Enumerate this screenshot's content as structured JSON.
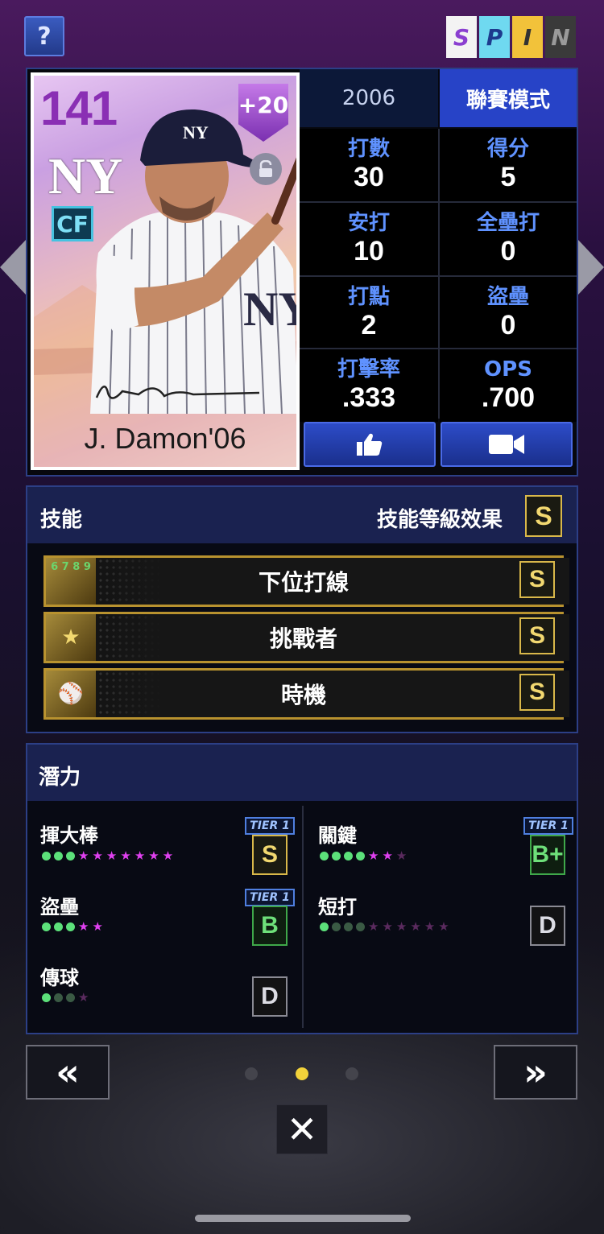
{
  "topbar": {
    "help_label": "?",
    "spin_letters": [
      {
        "letter": "S",
        "bg": "#f3f3f3",
        "color": "#8a3fd0"
      },
      {
        "letter": "P",
        "bg": "#6fd9f0",
        "color": "#1d3b8e"
      },
      {
        "letter": "I",
        "bg": "#f2c23a",
        "color": "#333333"
      },
      {
        "letter": "N",
        "bg": "#3a3a3a",
        "color": "#9a9a9a"
      }
    ]
  },
  "card": {
    "rating": "141",
    "position": "CF",
    "boost": "+20",
    "team_logo": "NY",
    "name": "J. Damon'06"
  },
  "stats": {
    "year_tab": "2006",
    "mode_tab": "聯賽模式",
    "items": [
      {
        "label": "打數",
        "value": "30"
      },
      {
        "label": "得分",
        "value": "5"
      },
      {
        "label": "安打",
        "value": "10"
      },
      {
        "label": "全壘打",
        "value": "0"
      },
      {
        "label": "打點",
        "value": "2"
      },
      {
        "label": "盜壘",
        "value": "0"
      },
      {
        "label": "打擊率",
        "value": ".333"
      },
      {
        "label": "OPS",
        "value": ".700"
      }
    ]
  },
  "skills": {
    "title": "技能",
    "level_label": "技能等級效果",
    "overall_grade": "S",
    "items": [
      {
        "name": "下位打線",
        "grade": "S",
        "icon_text": "6 7 8 9"
      },
      {
        "name": "挑戰者",
        "grade": "S",
        "icon_text": "★"
      },
      {
        "name": "時機",
        "grade": "S",
        "icon_text": "⚾"
      }
    ]
  },
  "potential": {
    "title": "潛力",
    "items": [
      {
        "name": "揮大棒",
        "tier": "TIER 1",
        "grade": "S",
        "green": 3,
        "star_filled": 7,
        "star_empty": 0,
        "dark_green": 0
      },
      {
        "name": "關鍵",
        "tier": "TIER 1",
        "grade": "B+",
        "green": 4,
        "star_filled": 2,
        "star_empty": 1,
        "dark_green": 0
      },
      {
        "name": "盜壘",
        "tier": "TIER 1",
        "grade": "B",
        "green": 3,
        "star_filled": 2,
        "star_empty": 0,
        "dark_green": 0
      },
      {
        "name": "短打",
        "tier": "",
        "grade": "D",
        "green": 1,
        "star_filled": 0,
        "star_empty": 6,
        "dark_green": 3
      },
      {
        "name": "傳球",
        "tier": "",
        "grade": "D",
        "green": 1,
        "star_filled": 0,
        "star_empty": 1,
        "dark_green": 2
      }
    ]
  },
  "nav": {
    "prev_label": "«",
    "next_label": "»",
    "close_label": "✕",
    "page_count": 3,
    "active_page": 2
  }
}
